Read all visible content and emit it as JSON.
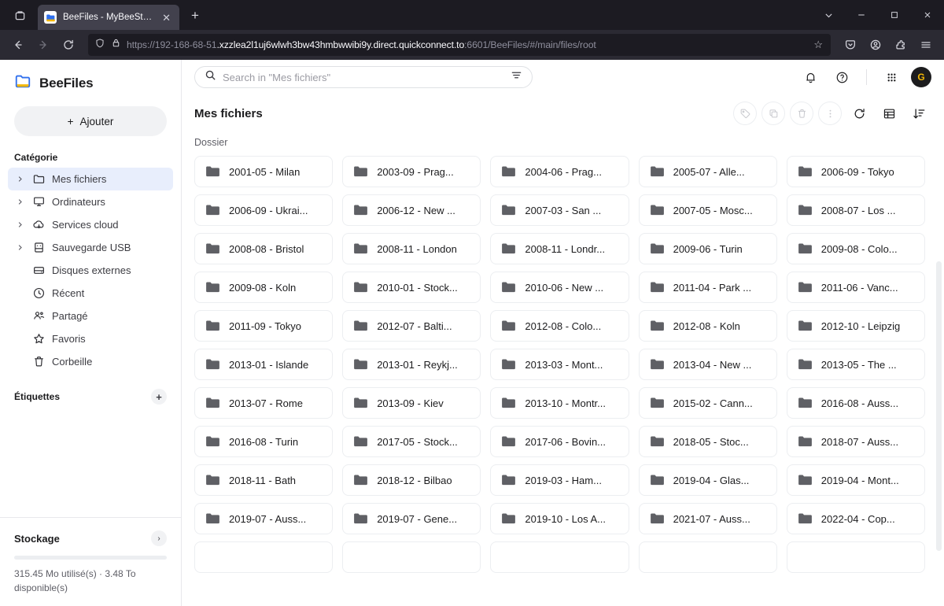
{
  "browser": {
    "tab": {
      "title": "BeeFiles - MyBeeStation",
      "close_label": "✕",
      "favicon": "folder-icon"
    },
    "new_tab_label": "+",
    "tab_list_icon": "tab-list-icon",
    "window_controls": {
      "minimize": "—",
      "maximize": "□",
      "close": "✕",
      "dropdown": "⌄"
    },
    "nav": {
      "back": "←",
      "forward": "→",
      "reload": "↻"
    },
    "url": {
      "prefix": "https://192-168-68-51",
      "host": ".xzzlea2l1uj6wlwh3bw43hmbwwibi9y.direct.quickconnect.to",
      "suffix": ":6601/BeeFiles/#/main/files/root"
    },
    "toolbar_icons": [
      "pocket-icon",
      "account-icon",
      "extensions-icon",
      "app-menu-icon"
    ],
    "bookmark_star": "☆"
  },
  "sidebar": {
    "brand": "BeeFiles",
    "add_button": "Ajouter",
    "add_plus": "+",
    "category_heading": "Catégorie",
    "items": [
      {
        "label": "Mes fichiers",
        "icon": "folder-icon",
        "expandable": true,
        "active": true
      },
      {
        "label": "Ordinateurs",
        "icon": "monitor-icon",
        "expandable": true,
        "active": false
      },
      {
        "label": "Services cloud",
        "icon": "cloud-icon",
        "expandable": true,
        "active": false
      },
      {
        "label": "Sauvegarde USB",
        "icon": "usb-drive-icon",
        "expandable": true,
        "active": false
      },
      {
        "label": "Disques externes",
        "icon": "external-drive-icon",
        "expandable": false,
        "active": false
      },
      {
        "label": "Récent",
        "icon": "clock-icon",
        "expandable": false,
        "active": false
      },
      {
        "label": "Partagé",
        "icon": "people-icon",
        "expandable": false,
        "active": false
      },
      {
        "label": "Favoris",
        "icon": "star-icon",
        "expandable": false,
        "active": false
      },
      {
        "label": "Corbeille",
        "icon": "trash-icon",
        "expandable": false,
        "active": false
      }
    ],
    "tags_heading": "Étiquettes",
    "tags_add": "+",
    "storage": {
      "title": "Stockage",
      "chevron": "›",
      "text": "315.45 Mo utilisé(s)  ·  3.48 To disponible(s)"
    }
  },
  "header": {
    "search_placeholder": "Search in \"Mes fichiers\"",
    "search_icon": "search-icon",
    "filter_icon": "filter-icon",
    "notification_icon": "bell-icon",
    "help_icon": "help-icon",
    "apps_icon": "apps-grid-icon",
    "avatar_initial": "G"
  },
  "toolbar": {
    "page_title": "Mes fichiers",
    "actions": [
      {
        "name": "tag-button",
        "icon": "tag-icon",
        "disabled": true
      },
      {
        "name": "copy-button",
        "icon": "copy-icon",
        "disabled": true
      },
      {
        "name": "delete-button",
        "icon": "trash-icon",
        "disabled": true
      },
      {
        "name": "more-button",
        "icon": "more-vertical-icon",
        "disabled": true
      }
    ],
    "refresh_icon": "refresh-icon",
    "view_icon": "list-view-icon",
    "sort_icon": "sort-descending-icon"
  },
  "content": {
    "group_label": "Dossier",
    "folders": [
      "2001-05 - Milan",
      "2003-09 - Prag...",
      "2004-06 - Prag...",
      "2005-07 - Alle...",
      "2006-09 - Tokyo",
      "2006-09 - Ukrai...",
      "2006-12 - New ...",
      "2007-03 - San ...",
      "2007-05 - Mosc...",
      "2008-07 - Los ...",
      "2008-08 - Bristol",
      "2008-11 - London",
      "2008-11 - Londr...",
      "2009-06 - Turin",
      "2009-08 - Colo...",
      "2009-08 - Koln",
      "2010-01 - Stock...",
      "2010-06 - New ...",
      "2011-04 - Park ...",
      "2011-06 - Vanc...",
      "2011-09 - Tokyo",
      "2012-07 - Balti...",
      "2012-08 - Colo...",
      "2012-08 - Koln",
      "2012-10 - Leipzig",
      "2013-01 - Islande",
      "2013-01 - Reykj...",
      "2013-03 - Mont...",
      "2013-04 - New ...",
      "2013-05 - The ...",
      "2013-07 - Rome",
      "2013-09 - Kiev",
      "2013-10 - Montr...",
      "2015-02 - Cann...",
      "2016-08 - Auss...",
      "2016-08 - Turin",
      "2017-05 - Stock...",
      "2017-06 - Bovin...",
      "2018-05 - Stoc...",
      "2018-07 - Auss...",
      "2018-11 - Bath",
      "2018-12 - Bilbao",
      "2019-03 - Ham...",
      "2019-04 - Glas...",
      "2019-04 - Mont...",
      "2019-07 - Auss...",
      "2019-07 - Gene...",
      "2019-10 - Los A...",
      "2021-07 - Auss...",
      "2022-04 - Cop...",
      "",
      "",
      "",
      "",
      ""
    ]
  },
  "colors": {
    "accent": "#2f6fed",
    "selected_bg": "#e8eefc",
    "chrome_bg": "#2b2a33",
    "tabstrip_bg": "#1c1b22",
    "brand_blue": "#2f6fed",
    "brand_yellow": "#f2b705",
    "folder_gray": "#5f6065"
  }
}
